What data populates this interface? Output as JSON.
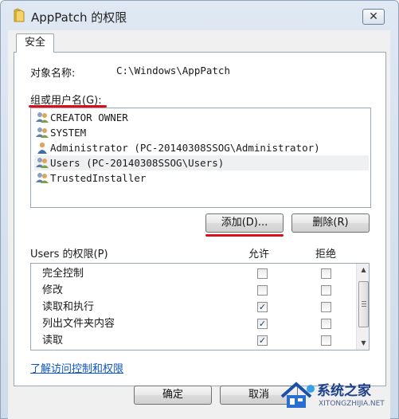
{
  "window": {
    "title": "AppPatch 的权限",
    "close_label": "✕"
  },
  "tabs": [
    {
      "label": "安全"
    }
  ],
  "object": {
    "label": "对象名称:",
    "value": "C:\\Windows\\AppPatch"
  },
  "groups": {
    "label": "组或用户名(G):",
    "items": [
      {
        "label": "CREATOR OWNER",
        "icon": "users-group-icon"
      },
      {
        "label": "SYSTEM",
        "icon": "users-group-icon"
      },
      {
        "label": "Administrator (PC-20140308SSOG\\Administrator)",
        "icon": "single-user-icon"
      },
      {
        "label": "Users (PC-20140308SSOG\\Users)",
        "icon": "users-group-icon",
        "selected": true
      },
      {
        "label": "TrustedInstaller",
        "icon": "users-group-icon"
      }
    ]
  },
  "buttons": {
    "add": "添加(D)...",
    "remove": "删除(R)",
    "ok": "确定",
    "cancel": "取消"
  },
  "permissions": {
    "header_label": "Users 的权限(P)",
    "allow_label": "允许",
    "deny_label": "拒绝",
    "rows": [
      {
        "name": "完全控制",
        "allow": false,
        "deny": false
      },
      {
        "name": "修改",
        "allow": false,
        "deny": false
      },
      {
        "name": "读取和执行",
        "allow": true,
        "deny": false
      },
      {
        "name": "列出文件夹内容",
        "allow": true,
        "deny": false
      },
      {
        "name": "读取",
        "allow": true,
        "deny": false
      }
    ]
  },
  "link": {
    "label": "了解访问控制和权限"
  },
  "watermark": {
    "text": "系统之家",
    "url": "XITONGZHIJIA.NET"
  },
  "colors": {
    "highlight_underline": "#d8101a",
    "link": "#0b56c6",
    "selection": "#eef0f2"
  }
}
